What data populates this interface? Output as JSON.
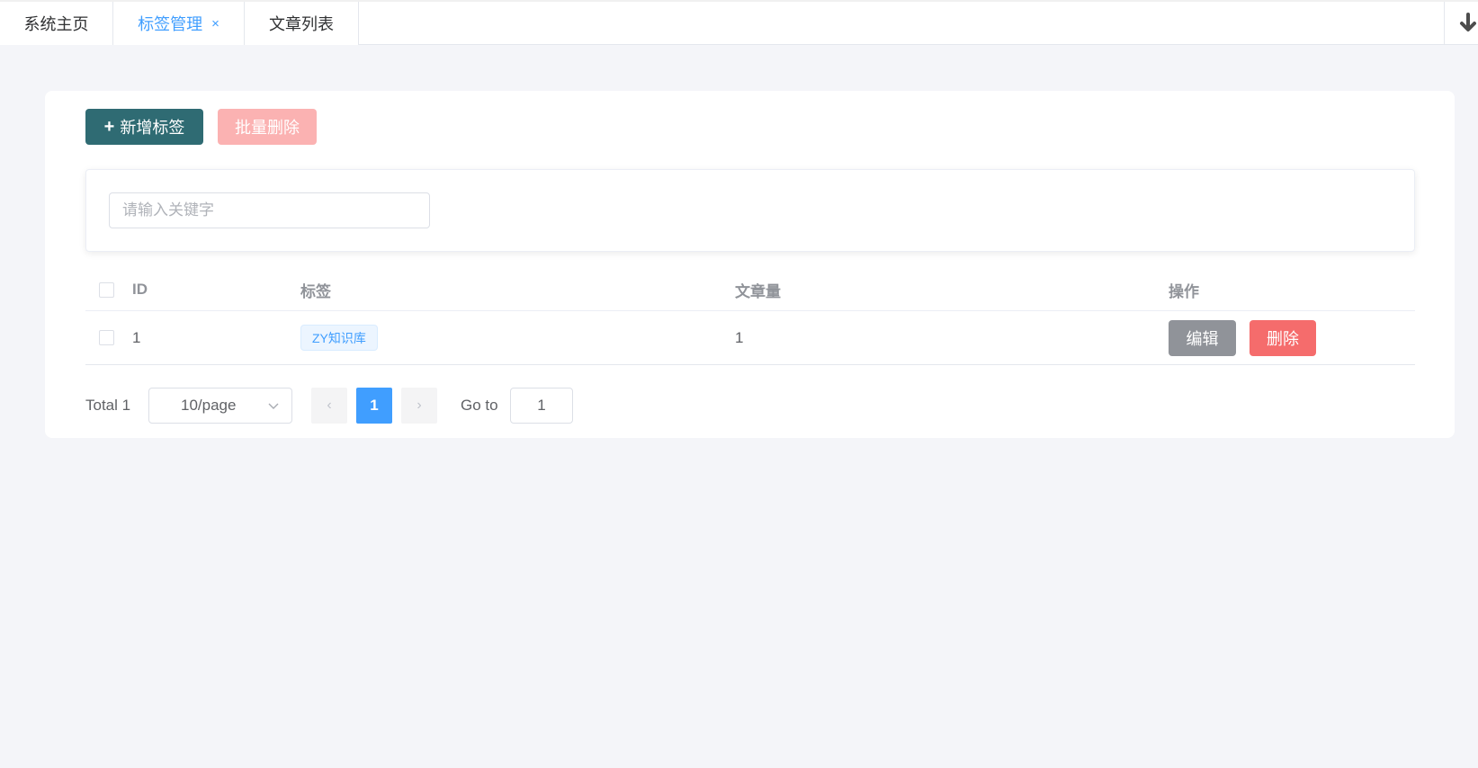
{
  "tabs": [
    {
      "label": "系统主页"
    },
    {
      "label": "标签管理",
      "close": "×",
      "active": true
    },
    {
      "label": "文章列表"
    }
  ],
  "toolbar": {
    "add_label": "新增标签",
    "add_icon": "+",
    "batch_delete_label": "批量删除"
  },
  "search": {
    "placeholder": "请输入关键字",
    "value": ""
  },
  "table": {
    "columns": [
      "ID",
      "标签",
      "文章量",
      "操作"
    ],
    "rows": [
      {
        "id": "1",
        "tag": "ZY知识库",
        "count": "1",
        "edit": "编辑",
        "delete": "删除"
      }
    ]
  },
  "pagination": {
    "total": "Total 1",
    "page_size": "10/page",
    "prev": "‹",
    "current": "1",
    "next": "›",
    "goto_label": "Go to",
    "goto_value": "1"
  },
  "colors": {
    "primary": "#409eff",
    "add_button": "#2f6b73",
    "batch_delete_disabled": "#fbb2b2",
    "edit_button": "#909399",
    "delete_button": "#f56c6c"
  }
}
